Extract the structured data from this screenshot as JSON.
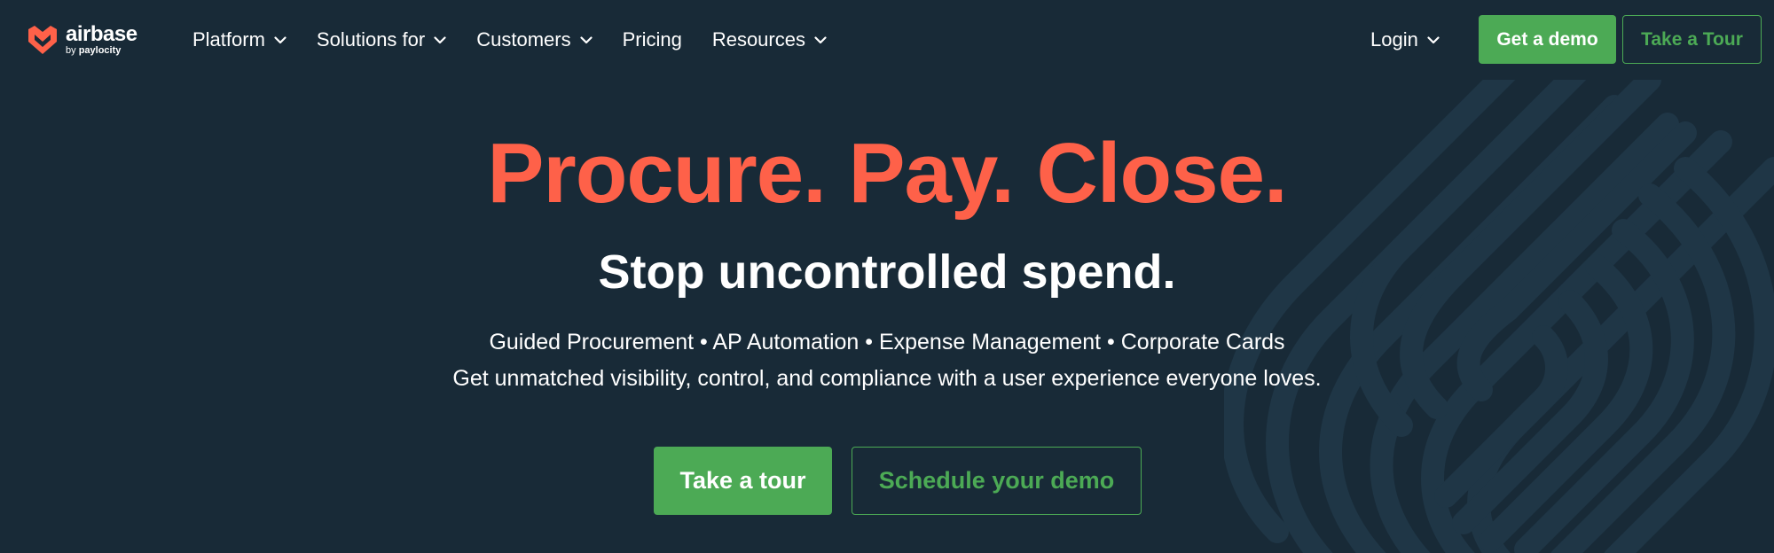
{
  "brand": {
    "name": "airbase",
    "sub_prefix": "by",
    "sub_company": "paylocity",
    "logo_color": "#fe6149"
  },
  "nav": {
    "items": [
      {
        "label": "Platform",
        "has_dropdown": true
      },
      {
        "label": "Solutions for",
        "has_dropdown": true
      },
      {
        "label": "Customers",
        "has_dropdown": true
      },
      {
        "label": "Pricing",
        "has_dropdown": false
      },
      {
        "label": "Resources",
        "has_dropdown": true
      }
    ],
    "login_label": "Login",
    "demo_label": "Get a demo",
    "tour_label": "Take a Tour"
  },
  "hero": {
    "title": "Procure. Pay. Close.",
    "subtitle": "Stop uncontrolled spend.",
    "features_line": "Guided Procurement • AP Automation • Expense Management • Corporate Cards",
    "tagline": "Get unmatched visibility, control, and compliance with a user experience everyone loves.",
    "cta_primary": "Take a tour",
    "cta_secondary": "Schedule your demo"
  },
  "colors": {
    "background": "#182a37",
    "accent": "#fe6149",
    "green": "#4caa55",
    "pattern": "#1f3646"
  }
}
